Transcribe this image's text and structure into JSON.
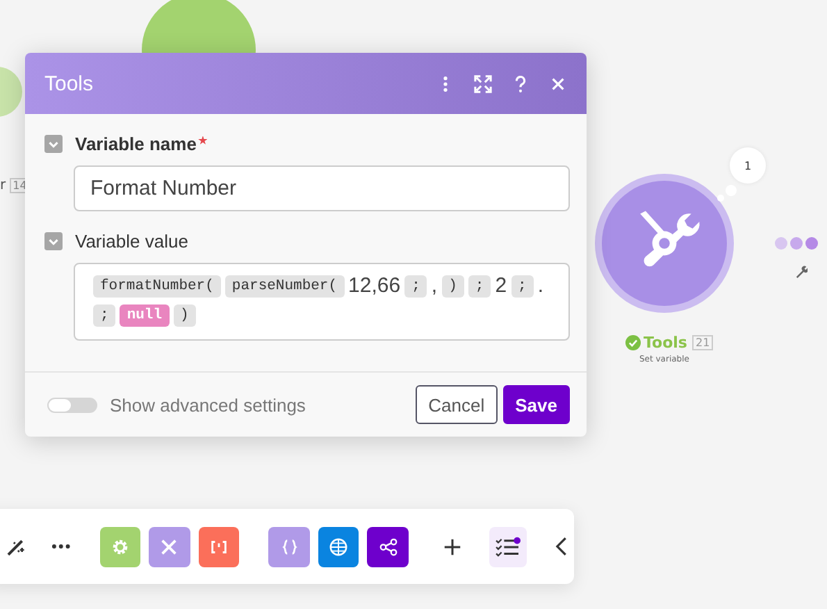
{
  "canvas": {
    "left_node": {
      "label": "r",
      "badge": "14"
    },
    "tools_node": {
      "name": "Tools",
      "badge": "21",
      "subtitle": "Set variable",
      "bubble": "1"
    }
  },
  "dialog": {
    "title": "Tools",
    "fields": [
      {
        "label": "Variable name",
        "required": true,
        "expanded": true,
        "kind": "text",
        "value": "Format Number"
      },
      {
        "label": "Variable value",
        "required": false,
        "expanded": true,
        "kind": "tokens",
        "tokens": [
          {
            "kind": "fn",
            "text": "formatNumber("
          },
          {
            "kind": "fn",
            "text": "parseNumber("
          },
          {
            "kind": "text",
            "text": "12,66"
          },
          {
            "kind": "sep",
            "text": ";"
          },
          {
            "kind": "text",
            "text": ","
          },
          {
            "kind": "sep",
            "text": ")"
          },
          {
            "kind": "sep",
            "text": ";"
          },
          {
            "kind": "text",
            "text": "2"
          },
          {
            "kind": "sep",
            "text": ";"
          },
          {
            "kind": "text",
            "text": "."
          },
          {
            "kind": "sep",
            "text": ";"
          },
          {
            "kind": "keyword",
            "text": "null"
          },
          {
            "kind": "sep",
            "text": ")"
          }
        ]
      }
    ],
    "advanced": {
      "label": "Show advanced settings",
      "on": false
    },
    "buttons": [
      {
        "kind": "secondary",
        "label": "Cancel"
      },
      {
        "kind": "primary",
        "label": "Save"
      }
    ]
  },
  "toolbar": [
    {
      "kind": "wand"
    },
    {
      "kind": "more"
    },
    {
      "kind": "gear",
      "color": "#a3d36f"
    },
    {
      "kind": "tools",
      "color": "#b09ae8"
    },
    {
      "kind": "brackets",
      "color": "#fb6f5a"
    },
    {
      "kind": "braces",
      "color": "#b09ae8"
    },
    {
      "kind": "globe",
      "color": "#0a84e0"
    },
    {
      "kind": "share",
      "color": "#6e00cc"
    },
    {
      "kind": "plus"
    },
    {
      "kind": "checklist"
    },
    {
      "kind": "chevron"
    }
  ]
}
